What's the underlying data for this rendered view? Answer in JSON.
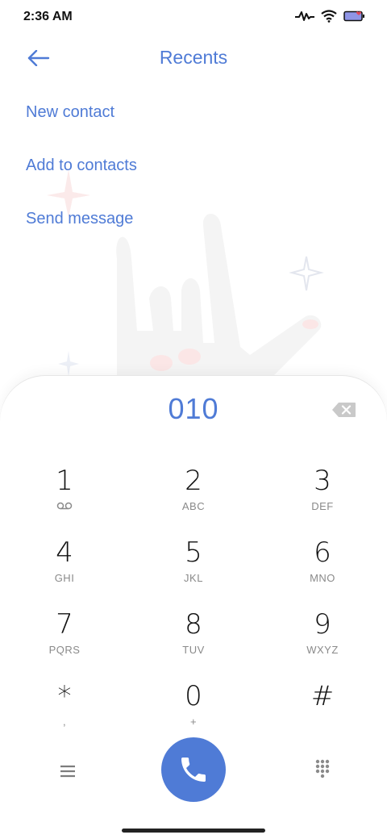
{
  "status_bar": {
    "time": "2:36 AM"
  },
  "header": {
    "title": "Recents"
  },
  "actions": [
    {
      "label": "New contact"
    },
    {
      "label": "Add to contacts"
    },
    {
      "label": "Send message"
    }
  ],
  "dialpad": {
    "number": "010",
    "keys": [
      {
        "digit": "1",
        "letters": ""
      },
      {
        "digit": "2",
        "letters": "ABC"
      },
      {
        "digit": "3",
        "letters": "DEF"
      },
      {
        "digit": "4",
        "letters": "GHI"
      },
      {
        "digit": "5",
        "letters": "JKL"
      },
      {
        "digit": "6",
        "letters": "MNO"
      },
      {
        "digit": "7",
        "letters": "PQRS"
      },
      {
        "digit": "8",
        "letters": "TUV"
      },
      {
        "digit": "9",
        "letters": "WXYZ"
      },
      {
        "digit": "*",
        "letters": ","
      },
      {
        "digit": "0",
        "letters": "+"
      },
      {
        "digit": "#",
        "letters": ""
      }
    ]
  },
  "colors": {
    "accent": "#4f7bd6"
  },
  "icons": {
    "back": "arrow-left-icon",
    "backspace": "backspace-icon",
    "voicemail": "voicemail-icon",
    "menu": "menu-icon",
    "call": "phone-icon",
    "keypad": "dialpad-grid-icon"
  }
}
